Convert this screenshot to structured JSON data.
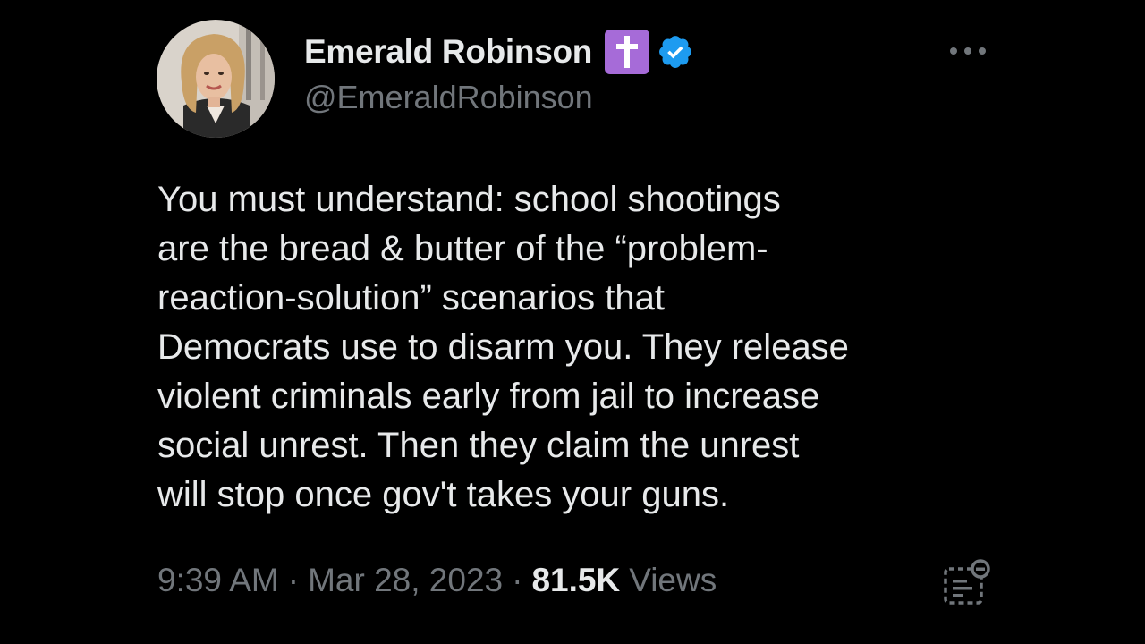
{
  "author": {
    "display_name": "Emerald Robinson",
    "handle": "@EmeraldRobinson",
    "badge_icon": "latin-cross-icon",
    "verified_icon": "verified-checkmark-icon"
  },
  "more_icon": "more-options-icon",
  "tweet": {
    "text": "You must understand: school shootings\nare the bread & butter of the “problem-\nreaction-solution” scenarios that\nDemocrats use to disarm you. They release\nviolent criminals early from jail to increase\nsocial unrest. Then they claim the unrest\nwill stop once gov't takes your guns."
  },
  "meta": {
    "time": "9:39 AM",
    "separator": "·",
    "date": "Mar 28, 2023",
    "views_count": "81.5K",
    "views_label": "Views",
    "analytics_icon": "analytics-icon"
  },
  "colors": {
    "background": "#000000",
    "primary_text": "#e7e9ea",
    "secondary_text": "#71767b",
    "verified_blue": "#1d9bf0",
    "cross_badge": "#a66bd8"
  }
}
